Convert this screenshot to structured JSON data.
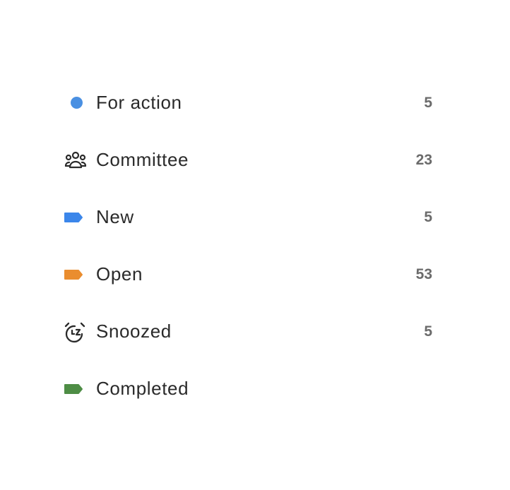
{
  "nav": {
    "items": [
      {
        "label": "For action",
        "count": "5",
        "icon": "dot-icon",
        "color": "#4a90e2"
      },
      {
        "label": "Committee",
        "count": "23",
        "icon": "people-group-icon",
        "color": "#2b2b2b"
      },
      {
        "label": "New",
        "count": "5",
        "icon": "tag-icon",
        "color": "#3b86ea"
      },
      {
        "label": "Open",
        "count": "53",
        "icon": "tag-icon",
        "color": "#ea8d2f"
      },
      {
        "label": "Snoozed",
        "count": "5",
        "icon": "snooze-alarm-icon",
        "color": "#2b2b2b"
      },
      {
        "label": "Completed",
        "count": "",
        "icon": "tag-icon",
        "color": "#4e8d45"
      }
    ]
  }
}
